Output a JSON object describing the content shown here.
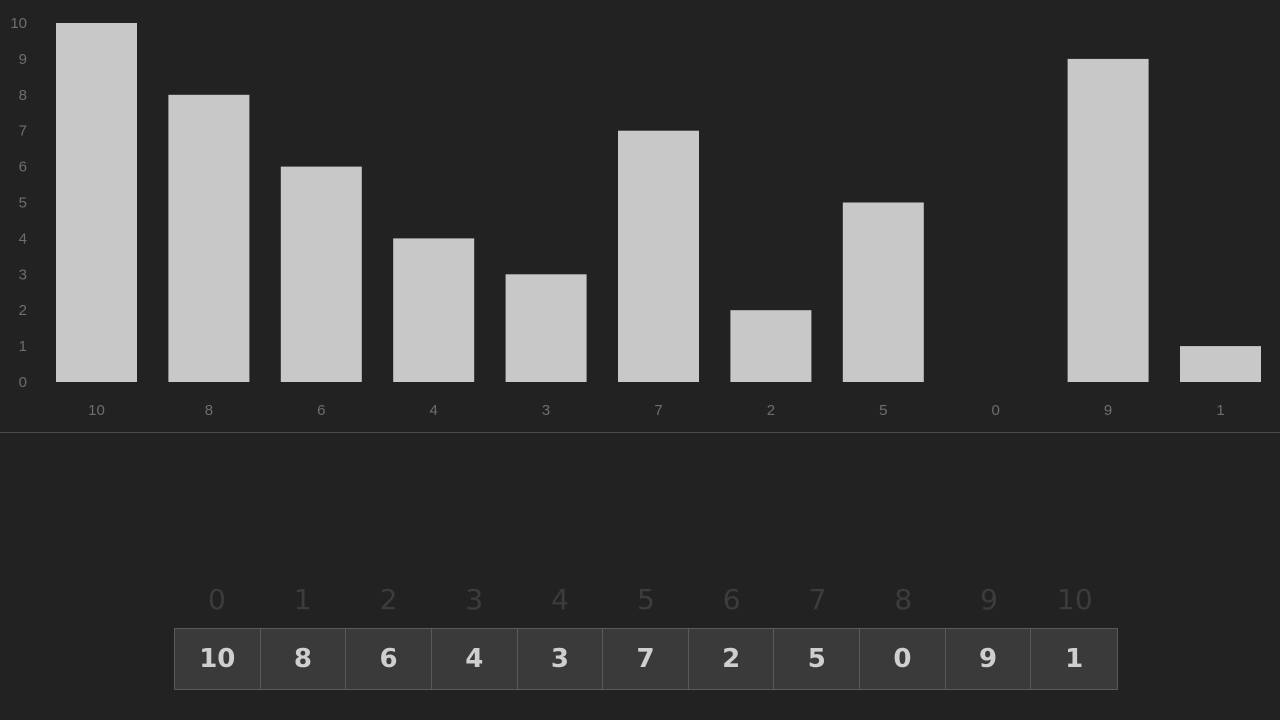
{
  "chart_data": {
    "type": "bar",
    "title": "",
    "xlabel": "",
    "ylabel": "",
    "categories": [
      "10",
      "8",
      "6",
      "4",
      "3",
      "7",
      "2",
      "5",
      "0",
      "9",
      "1"
    ],
    "values": [
      10,
      8,
      6,
      4,
      3,
      7,
      2,
      5,
      0,
      9,
      1
    ],
    "ylim": [
      0,
      10
    ],
    "yticks": [
      "0",
      "1",
      "2",
      "3",
      "4",
      "5",
      "6",
      "7",
      "8",
      "9",
      "10"
    ],
    "grid": false,
    "colors": {
      "background": "#222222",
      "bar": "#c8c8c8",
      "tick_label": "#6e6e6e"
    }
  },
  "array_view": {
    "indices": [
      "0",
      "1",
      "2",
      "3",
      "4",
      "5",
      "6",
      "7",
      "8",
      "9",
      "10"
    ],
    "cells": [
      "10",
      "8",
      "6",
      "4",
      "3",
      "7",
      "2",
      "5",
      "0",
      "9",
      "1"
    ]
  }
}
